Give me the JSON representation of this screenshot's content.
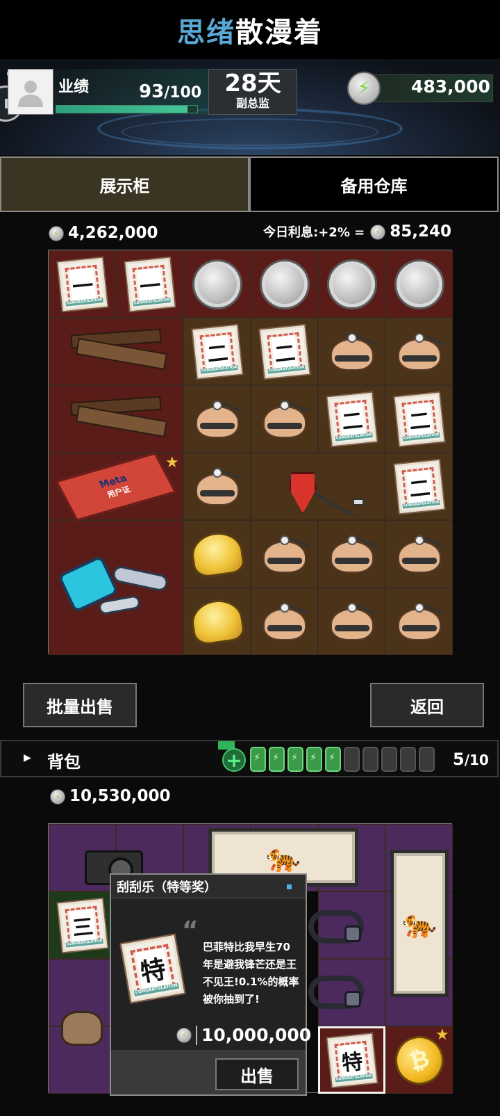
{
  "title": {
    "part1": "思绪",
    "part2": "散漫着"
  },
  "hud": {
    "performance_label": "业绩",
    "performance_current": "93",
    "performance_max": "/100",
    "performance_progress": 0.93,
    "days": "28天",
    "rank": "副总监",
    "coins": "483,000"
  },
  "tabs": [
    {
      "label": "展示柜",
      "active": true
    },
    {
      "label": "备用仓库",
      "active": false
    }
  ],
  "showcase": {
    "balance": "4,262,000",
    "interest_label": "今日利息:+2% =",
    "interest_value": "85,240",
    "tickets": {
      "one": "一",
      "two": "二",
      "three": "三",
      "special": "特"
    },
    "meta_card": {
      "brand": "Meta",
      "subtitle": "用户证"
    }
  },
  "actions": {
    "bulk_sell": "批量出售",
    "back": "返回"
  },
  "backpack": {
    "label": "背包",
    "plus": "+",
    "batteries_full": 5,
    "batteries_total": 10,
    "count_current": "5",
    "count_total": "/10",
    "balance": "10,530,000",
    "gold_coin_symbol": "₿"
  },
  "popup": {
    "title": "刮刮乐（特等奖）",
    "ticket_char": "特",
    "description": "巴菲特比我早生70年是避我锋芒还是王不见王!0.1%的概率被你抽到了!",
    "price": "10,000,000",
    "sell": "出售"
  },
  "colors": {
    "accent_blue": "#5aa8d6",
    "progress_green": "#46c497",
    "active_tab": "#3a3522"
  },
  "icons": {
    "coin": "lightning-coin-icon",
    "settings": "gear-icon",
    "pause": "pause-icon",
    "star": "star-icon"
  }
}
